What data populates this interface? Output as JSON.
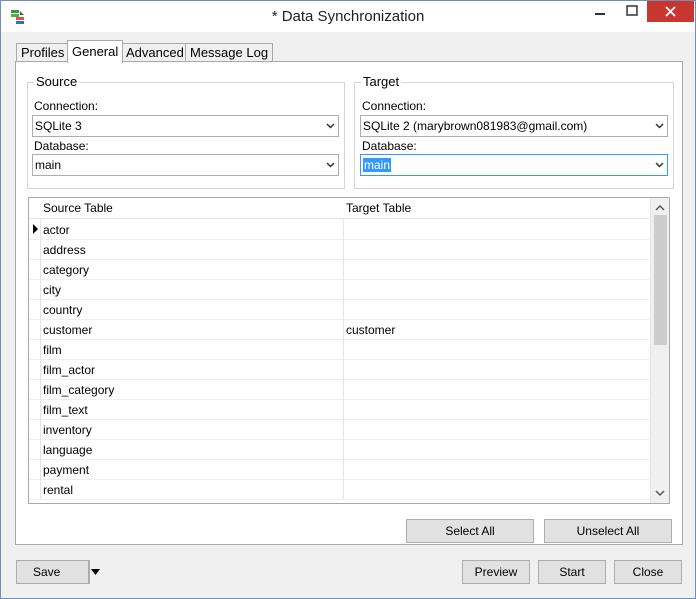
{
  "window": {
    "title": "* Data Synchronization"
  },
  "tabs": [
    {
      "label": "Profiles"
    },
    {
      "label": "General"
    },
    {
      "label": "Advanced"
    },
    {
      "label": "Message Log"
    }
  ],
  "source": {
    "legend": "Source",
    "connection_label": "Connection:",
    "connection_value": "SQLite 3",
    "database_label": "Database:",
    "database_value": "main"
  },
  "target": {
    "legend": "Target",
    "connection_label": "Connection:",
    "connection_value": "SQLite 2 (marybrown081983@gmail.com)",
    "database_label": "Database:",
    "database_value": "main"
  },
  "grid": {
    "headers": [
      "Source Table",
      "Target Table"
    ],
    "rows": [
      {
        "source": "actor",
        "target": ""
      },
      {
        "source": "address",
        "target": ""
      },
      {
        "source": "category",
        "target": ""
      },
      {
        "source": "city",
        "target": ""
      },
      {
        "source": "country",
        "target": ""
      },
      {
        "source": "customer",
        "target": "customer"
      },
      {
        "source": "film",
        "target": ""
      },
      {
        "source": "film_actor",
        "target": ""
      },
      {
        "source": "film_category",
        "target": ""
      },
      {
        "source": "film_text",
        "target": ""
      },
      {
        "source": "inventory",
        "target": ""
      },
      {
        "source": "language",
        "target": ""
      },
      {
        "source": "payment",
        "target": ""
      },
      {
        "source": "rental",
        "target": ""
      }
    ]
  },
  "buttons": {
    "select_all": "Select All",
    "unselect_all": "Unselect All",
    "save": "Save",
    "preview": "Preview",
    "start": "Start",
    "close": "Close"
  },
  "colors": {
    "close_button": "#c7372f",
    "selection": "#3399ff"
  }
}
